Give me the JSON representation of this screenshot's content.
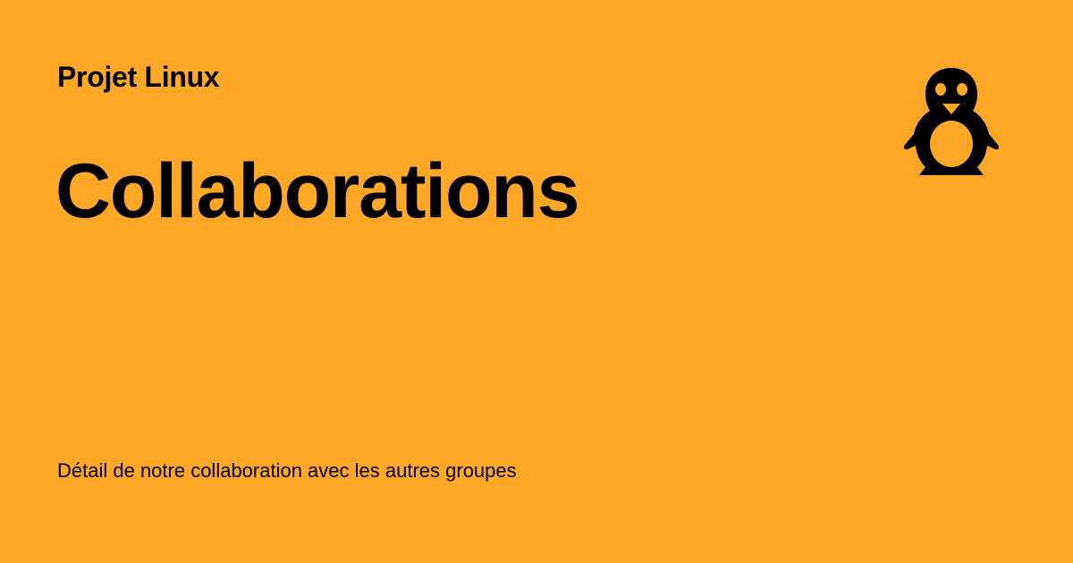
{
  "site": {
    "name": "Projet Linux",
    "logo_icon": "tux-penguin-icon"
  },
  "page": {
    "title": "Collaborations",
    "description": "Détail de notre collaboration avec les autres groupes"
  },
  "colors": {
    "background": "#FFA726",
    "text": "#000000"
  }
}
